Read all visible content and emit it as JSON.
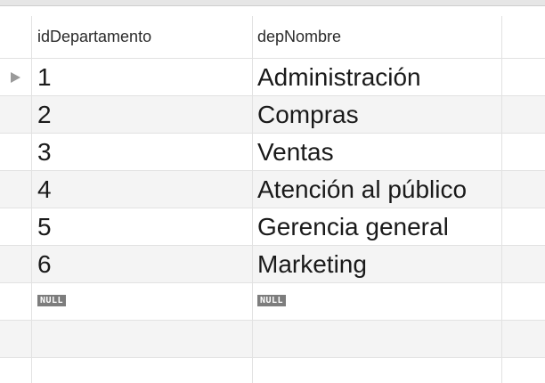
{
  "table": {
    "columns": [
      "idDepartamento",
      "depNombre"
    ],
    "rows": [
      {
        "id": "1",
        "name": "Administración",
        "selected": true
      },
      {
        "id": "2",
        "name": "Compras"
      },
      {
        "id": "3",
        "name": "Ventas"
      },
      {
        "id": "4",
        "name": "Atención al público"
      },
      {
        "id": "5",
        "name": "Gerencia general"
      },
      {
        "id": "6",
        "name": "Marketing"
      }
    ],
    "new_row": {
      "id": "NULL",
      "name": "NULL"
    }
  },
  "icons": {
    "current_row_indicator": "play-arrow-icon"
  },
  "colors": {
    "row_alt_background": "#f4f4f4",
    "null_badge_background": "#7d7d7d",
    "grid_line": "#e2e2e2"
  }
}
